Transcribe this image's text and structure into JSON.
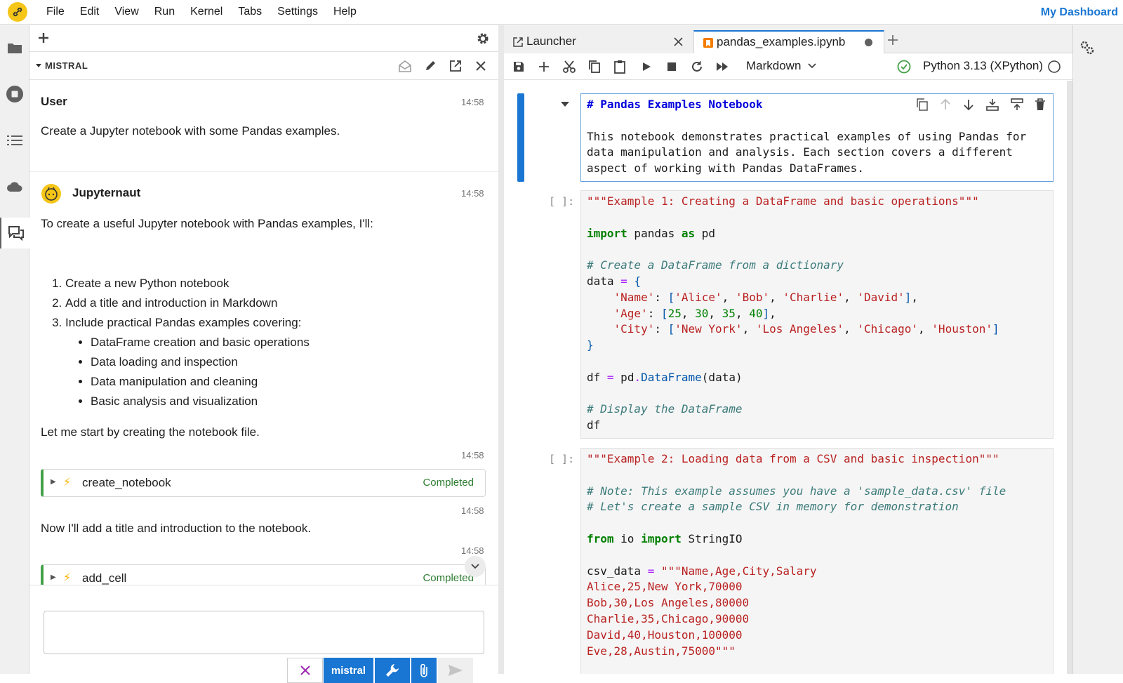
{
  "menubar": {
    "items": [
      "File",
      "Edit",
      "View",
      "Run",
      "Kernel",
      "Tabs",
      "Settings",
      "Help"
    ],
    "dashboard_link": "My Dashboard"
  },
  "chat": {
    "title": "MISTRAL",
    "messages": [
      {
        "author": "User",
        "time": "14:58",
        "text": "Create a Jupyter notebook with some Pandas examples."
      },
      {
        "author": "Jupyternaut",
        "time": "14:58",
        "intro": "To create a useful Jupyter notebook with Pandas examples, I'll:",
        "steps": [
          "Create a new Python notebook",
          "Add a title and introduction in Markdown",
          "Include practical Pandas examples covering:"
        ],
        "substeps": [
          "DataFrame creation and basic operations",
          "Data loading and inspection",
          "Data manipulation and cleaning",
          "Basic analysis and visualization"
        ],
        "outro": "Let me start by creating the notebook file."
      }
    ],
    "tool_calls": [
      {
        "time": "14:58",
        "name": "create_notebook",
        "status": "Completed"
      },
      {
        "time": "14:58",
        "text_after": "Now I'll add a title and introduction to the notebook."
      },
      {
        "time": "14:58",
        "name": "add_cell",
        "status": "Completed"
      }
    ],
    "composer": {
      "placeholder": "",
      "model_label": "mistral"
    }
  },
  "notebook": {
    "tabs": [
      {
        "label": "Launcher"
      },
      {
        "label": "pandas_examples.ipynb"
      }
    ],
    "cell_type": "Markdown",
    "kernel": "Python 3.13 (XPython)",
    "markdown_cell": {
      "heading": "# Pandas Examples Notebook",
      "body": [
        "This notebook demonstrates practical examples of using Pandas for",
        "data manipulation and analysis. Each section covers a different",
        "aspect of working with Pandas DataFrames."
      ]
    },
    "code_cells": [
      {
        "prompt": "[ ]:"
      },
      {
        "prompt": "[ ]:"
      }
    ]
  },
  "colors": {
    "accent": "#1976d2",
    "success": "#2e7d32",
    "logo": "#f5c518"
  }
}
